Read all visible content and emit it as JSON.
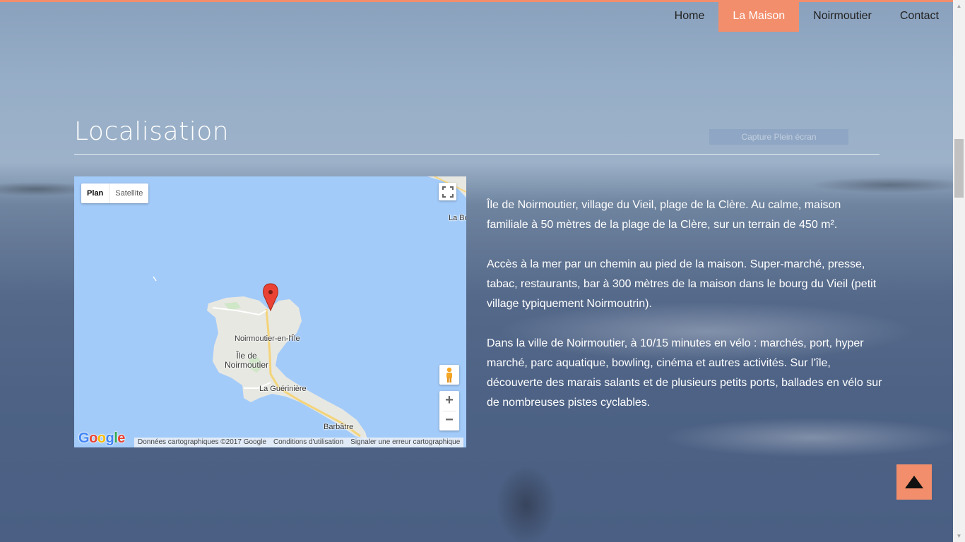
{
  "nav": {
    "items": [
      {
        "label": "Home"
      },
      {
        "label": "La Maison"
      },
      {
        "label": "Noirmoutier"
      },
      {
        "label": "Contact"
      }
    ],
    "active": "La Maison"
  },
  "section": {
    "title": "Localisation",
    "capture_label": "Capture Plein écran"
  },
  "map": {
    "type_plan": "Plan",
    "type_satellite": "Satellite",
    "labels": {
      "la_bo": "La Bo",
      "noirmoutier_en_l_ile": "Noirmoutier-en-l'Île",
      "ile_de_noirmoutier_1": "Île de",
      "ile_de_noirmoutier_2": "Noirmoutier",
      "la_gueriniere": "La Guérinière",
      "barbatre": "Barbâtre"
    },
    "zoom_in": "+",
    "zoom_out": "−",
    "attribution": {
      "data": "Données cartographiques ©2017 Google",
      "terms": "Conditions d'utilisation",
      "report": "Signaler une erreur cartographique"
    },
    "logo_letters": [
      "G",
      "o",
      "o",
      "g",
      "l",
      "e"
    ]
  },
  "description": {
    "paragraphs": [
      "Île de Noirmoutier, village du Vieil, plage de la Clère. Au calme, maison familiale à 50 mètres de la plage de la Clère, sur un terrain de 450 m².",
      "Accès à la mer par un chemin au pied de la maison. Super-marché, presse, tabac, restaurants, bar à 300 mètres de la maison dans le bourg du Vieil (petit village typiquement Noirmoutrin).",
      "Dans la ville de Noirmoutier, à 10/15 minutes en vélo : marchés, port, hyper marché, parc aquatique, bowling, cinéma et autres activités. Sur l'île, découverte des marais salants et de plusieurs petits ports, ballades en vélo sur de nombreuses pistes cyclables."
    ]
  },
  "colors": {
    "accent": "#f28e6b",
    "water": "#a3cbf9",
    "land": "#e8e8e2"
  },
  "icons": {
    "fullscreen": "fullscreen-icon",
    "pegman": "pegman-icon",
    "marker": "map-marker-icon",
    "back_to_top": "triangle-up-icon"
  }
}
